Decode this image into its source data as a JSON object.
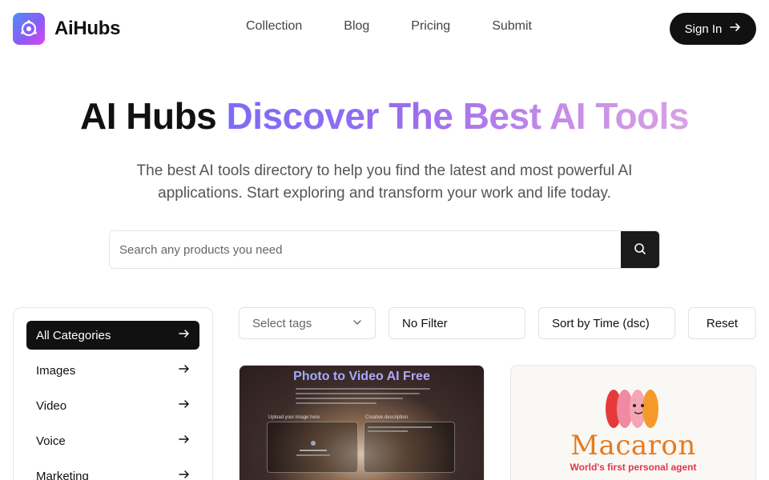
{
  "header": {
    "brand": "AiHubs",
    "nav": [
      "Collection",
      "Blog",
      "Pricing",
      "Submit"
    ],
    "signin_label": "Sign In"
  },
  "hero": {
    "title_plain": "AI Hubs",
    "title_gradient": "Discover The Best AI Tools",
    "subtitle": "The best AI tools directory to help you find the latest and most powerful AI applications. Start exploring and transform your work and life today."
  },
  "search": {
    "placeholder": "Search any products you need",
    "value": ""
  },
  "sidebar": {
    "items": [
      {
        "label": "All Categories",
        "active": true
      },
      {
        "label": "Images",
        "active": false
      },
      {
        "label": "Video",
        "active": false
      },
      {
        "label": "Voice",
        "active": false
      },
      {
        "label": "Marketing",
        "active": false
      }
    ]
  },
  "filters": {
    "tags_placeholder": "Select tags",
    "filter_value": "No Filter",
    "sort_value": "Sort by Time (dsc)",
    "reset_label": "Reset"
  },
  "cards": [
    {
      "title": "Photo to Video AI Free",
      "panel_left_label": "Upload your image here",
      "panel_right_label": "Creative description"
    },
    {
      "title": "Macaron",
      "subtitle": "World's first personal agent"
    }
  ],
  "colors": {
    "accent_dark": "#111111",
    "gradient_start": "#7b6cf6",
    "gradient_end": "#d7a3e4",
    "macaron_orange": "#e67a1f",
    "macaron_red": "#e0364d"
  }
}
